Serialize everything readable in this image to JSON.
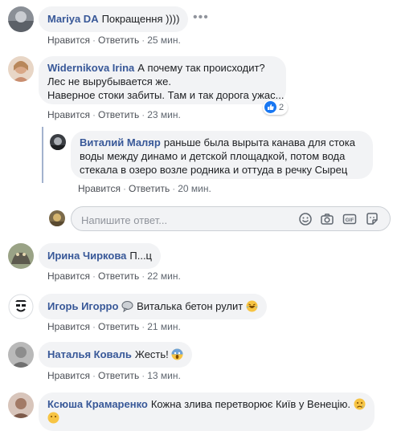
{
  "actions": {
    "like": "Нравится",
    "reply": "Ответить"
  },
  "comments": [
    {
      "author": "Mariya DA",
      "text": "Покращення ))))",
      "time": "25 мин."
    },
    {
      "author": "Widernikova Irina",
      "lines": [
        "А почему так происходит?",
        "Лес не вырубывается же.",
        "Наверное стоки забиты. Там и так дорога ужас..."
      ],
      "time": "23 мин.",
      "reactions": "2"
    },
    {
      "author": "Виталий Маляр",
      "lines": [
        "раньше была вырыта канава для стока",
        "воды между динамо и детской площадкой, потом вода",
        "стекала в озеро возле родника и оттуда в речку Сырец"
      ],
      "time": "20 мин."
    },
    {
      "author": "Ирина Чиркова",
      "text": "П...ц",
      "time": "22 мин."
    },
    {
      "author": "Игорь Игорро",
      "text": "Виталька бетон рулит",
      "time": "21 мин."
    },
    {
      "author": "Наталья Коваль",
      "text": "Жесть!",
      "time": "13 мин."
    },
    {
      "author": "Ксюша Крамаренко",
      "text": "Кожна злива перетворює Київ у Венецію."
    }
  ],
  "reply_box": {
    "placeholder": "Напишите ответ..."
  },
  "icons": [
    "more-options-icon",
    "like-icon",
    "smiley-icon",
    "camera-icon",
    "gif-icon",
    "sticker-icon"
  ]
}
